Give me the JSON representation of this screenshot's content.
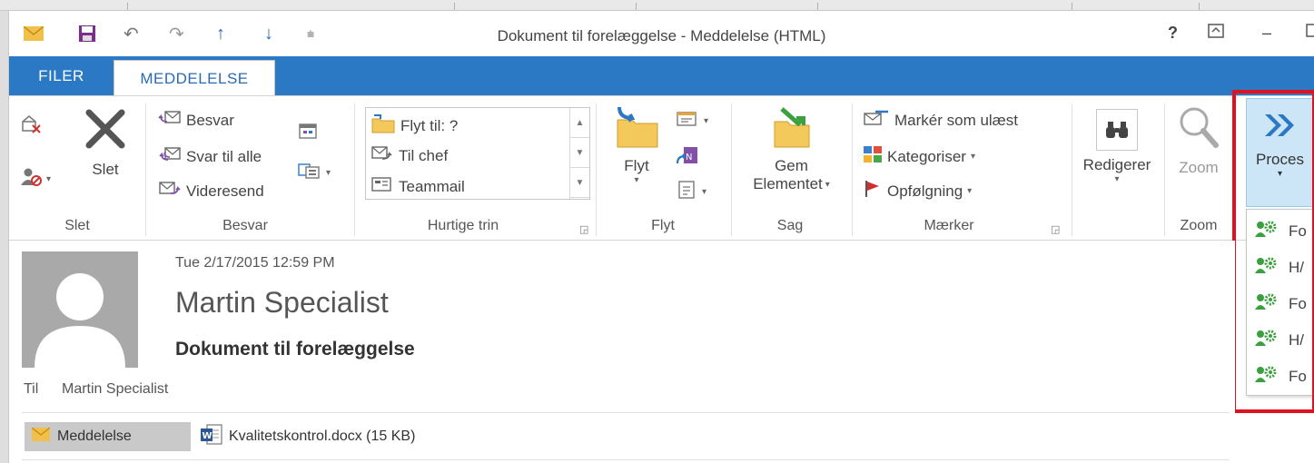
{
  "window": {
    "title": "Dokument til forelæggelse - Meddelelse (HTML)",
    "help": "?",
    "restore_icon": "ribbon-display-icon",
    "minimize": "–"
  },
  "qat": {
    "undo": "↶",
    "redo": "↷",
    "up": "↑",
    "down": "↓",
    "customize": "⩧"
  },
  "tabs": {
    "filer": "FILER",
    "meddelelse": "MEDDELELSE"
  },
  "ribbon": {
    "slet_group": {
      "label": "Slet",
      "slet": "Slet"
    },
    "besvar_group": {
      "label": "Besvar",
      "besvar": "Besvar",
      "svar_til_alle": "Svar til alle",
      "videresend": "Videresend"
    },
    "hurtige_trin": {
      "label": "Hurtige trin",
      "items": [
        "Flyt til: ?",
        "Til chef",
        "Teammail"
      ]
    },
    "flyt_group": {
      "label": "Flyt",
      "flyt": "Flyt"
    },
    "sag_group": {
      "label": "Sag",
      "gem_line1": "Gem",
      "gem_line2": "Elementet"
    },
    "maerker_group": {
      "label": "Mærker",
      "marker": "Markér som ulæst",
      "kategoriser": "Kategoriser",
      "opfoelgning": "Opfølgning"
    },
    "redigerer": "Redigerer",
    "zoom_group": {
      "label": "Zoom",
      "zoom": "Zoom"
    },
    "proces": {
      "label": "Proces",
      "menu": [
        "Fo",
        "H/",
        "Fo",
        "H/",
        "Fo"
      ]
    }
  },
  "message": {
    "date": "Tue 2/17/2015 12:59 PM",
    "sender": "Martin Specialist",
    "subject": "Dokument til forelæggelse",
    "to_label": "Til",
    "to_value": "Martin Specialist",
    "tab_label": "Meddelelse",
    "attachment": "Kvalitetskontrol.docx (15 KB)"
  },
  "colors": {
    "accent": "#2b79c5",
    "highlight": "#e0121f",
    "proces_bg": "#cde6f7"
  }
}
